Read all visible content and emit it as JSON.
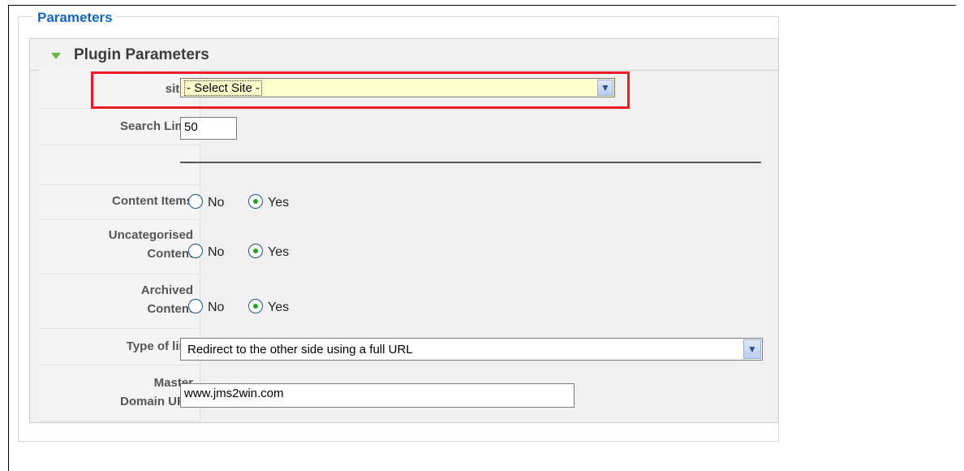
{
  "fieldset": {
    "legend": "Parameters"
  },
  "panel": {
    "title": "Plugin Parameters"
  },
  "rows": {
    "sites": {
      "label": "sites",
      "selected": "- Select Site -"
    },
    "search_limit": {
      "label": "Search Limit",
      "value": "50"
    },
    "content_items": {
      "label": "Content Items",
      "no": "No",
      "yes": "Yes",
      "selected": "Yes"
    },
    "uncategorised": {
      "label_line1": "Uncategorised",
      "label_line2": "Content",
      "no": "No",
      "yes": "Yes",
      "selected": "Yes"
    },
    "archived": {
      "label_line1": "Archived",
      "label_line2": "Content",
      "no": "No",
      "yes": "Yes",
      "selected": "Yes"
    },
    "type_of_link": {
      "label": "Type of link",
      "selected": "Redirect to the other side using a full URL"
    },
    "master_domain": {
      "label_line1": "Master",
      "label_line2": "Domain URL",
      "value": "www.jms2win.com"
    }
  },
  "colors": {
    "legend": "#1566c0",
    "highlight": "#ee1c24",
    "radio_dot": "#23a323",
    "triangle": "#6bb83f"
  },
  "icons": {
    "collapse": "triangle-down-icon",
    "dropdown": "chevron-down-icon"
  }
}
